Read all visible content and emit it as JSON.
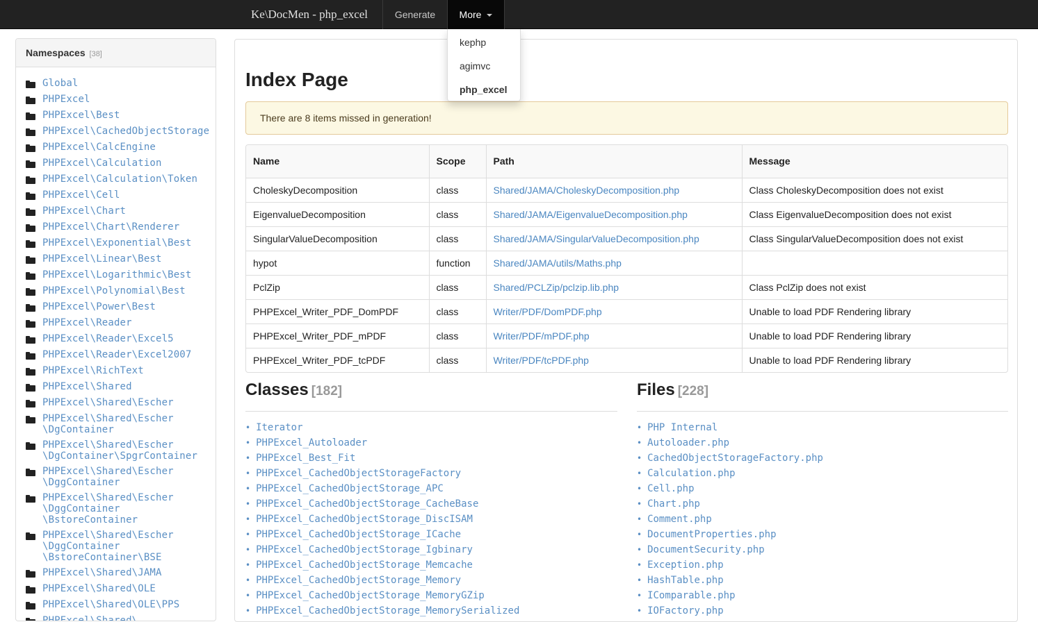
{
  "navbar": {
    "brand": "Ke\\DocMen - php_excel",
    "generate_label": "Generate",
    "more_label": "More"
  },
  "dropdown": {
    "items": [
      {
        "label": "kephp",
        "active": false
      },
      {
        "label": "agimvc",
        "active": false
      },
      {
        "label": "php_excel",
        "active": true
      }
    ]
  },
  "sidebar": {
    "title": "Namespaces",
    "count": "[38]",
    "items": [
      "Global",
      "PHPExcel",
      "PHPExcel\\Best",
      "PHPExcel\\CachedObjectStorage",
      "PHPExcel\\CalcEngine",
      "PHPExcel\\Calculation",
      "PHPExcel\\Calculation\\Token",
      "PHPExcel\\Cell",
      "PHPExcel\\Chart",
      "PHPExcel\\Chart\\Renderer",
      "PHPExcel\\Exponential\\Best",
      "PHPExcel\\Linear\\Best",
      "PHPExcel\\Logarithmic\\Best",
      "PHPExcel\\Polynomial\\Best",
      "PHPExcel\\Power\\Best",
      "PHPExcel\\Reader",
      "PHPExcel\\Reader\\Excel5",
      "PHPExcel\\Reader\\Excel2007",
      "PHPExcel\\RichText",
      "PHPExcel\\Shared",
      "PHPExcel\\Shared\\Escher",
      "PHPExcel\\Shared\\Escher\n\\DgContainer",
      "PHPExcel\\Shared\\Escher\n\\DgContainer\\SpgrContainer",
      "PHPExcel\\Shared\\Escher\n\\DggContainer",
      "PHPExcel\\Shared\\Escher\n\\DggContainer\n\\BstoreContainer",
      "PHPExcel\\Shared\\Escher\n\\DggContainer\n\\BstoreContainer\\BSE",
      "PHPExcel\\Shared\\JAMA",
      "PHPExcel\\Shared\\OLE",
      "PHPExcel\\Shared\\OLE\\PPS",
      "PHPExcel\\Shared\\"
    ]
  },
  "main": {
    "title": "Index Page",
    "alert": "There are 8 items missed in generation!",
    "table": {
      "headers": [
        "Name",
        "Scope",
        "Path",
        "Message"
      ],
      "rows": [
        [
          "CholeskyDecomposition",
          "class",
          "Shared/JAMA/CholeskyDecomposition.php",
          "Class CholeskyDecomposition does not exist"
        ],
        [
          "EigenvalueDecomposition",
          "class",
          "Shared/JAMA/EigenvalueDecomposition.php",
          "Class EigenvalueDecomposition does not exist"
        ],
        [
          "SingularValueDecomposition",
          "class",
          "Shared/JAMA/SingularValueDecomposition.php",
          "Class SingularValueDecomposition does not exist"
        ],
        [
          "hypot",
          "function",
          "Shared/JAMA/utils/Maths.php",
          ""
        ],
        [
          "PclZip",
          "class",
          "Shared/PCLZip/pclzip.lib.php",
          "Class PclZip does not exist"
        ],
        [
          "PHPExcel_Writer_PDF_DomPDF",
          "class",
          "Writer/PDF/DomPDF.php",
          "Unable to load PDF Rendering library"
        ],
        [
          "PHPExcel_Writer_PDF_mPDF",
          "class",
          "Writer/PDF/mPDF.php",
          "Unable to load PDF Rendering library"
        ],
        [
          "PHPExcel_Writer_PDF_tcPDF",
          "class",
          "Writer/PDF/tcPDF.php",
          "Unable to load PDF Rendering library"
        ]
      ]
    },
    "classes": {
      "title": "Classes",
      "count": "[182]",
      "items": [
        "Iterator",
        "PHPExcel_Autoloader",
        "PHPExcel_Best_Fit",
        "PHPExcel_CachedObjectStorageFactory",
        "PHPExcel_CachedObjectStorage_APC",
        "PHPExcel_CachedObjectStorage_CacheBase",
        "PHPExcel_CachedObjectStorage_DiscISAM",
        "PHPExcel_CachedObjectStorage_ICache",
        "PHPExcel_CachedObjectStorage_Igbinary",
        "PHPExcel_CachedObjectStorage_Memcache",
        "PHPExcel_CachedObjectStorage_Memory",
        "PHPExcel_CachedObjectStorage_MemoryGZip",
        "PHPExcel_CachedObjectStorage_MemorySerialized"
      ]
    },
    "files": {
      "title": "Files",
      "count": "[228]",
      "items": [
        "PHP Internal",
        "Autoloader.php",
        "CachedObjectStorageFactory.php",
        "Calculation.php",
        "Cell.php",
        "Chart.php",
        "Comment.php",
        "DocumentProperties.php",
        "DocumentSecurity.php",
        "Exception.php",
        "HashTable.php",
        "IComparable.php",
        "IOFactory.php"
      ]
    }
  }
}
